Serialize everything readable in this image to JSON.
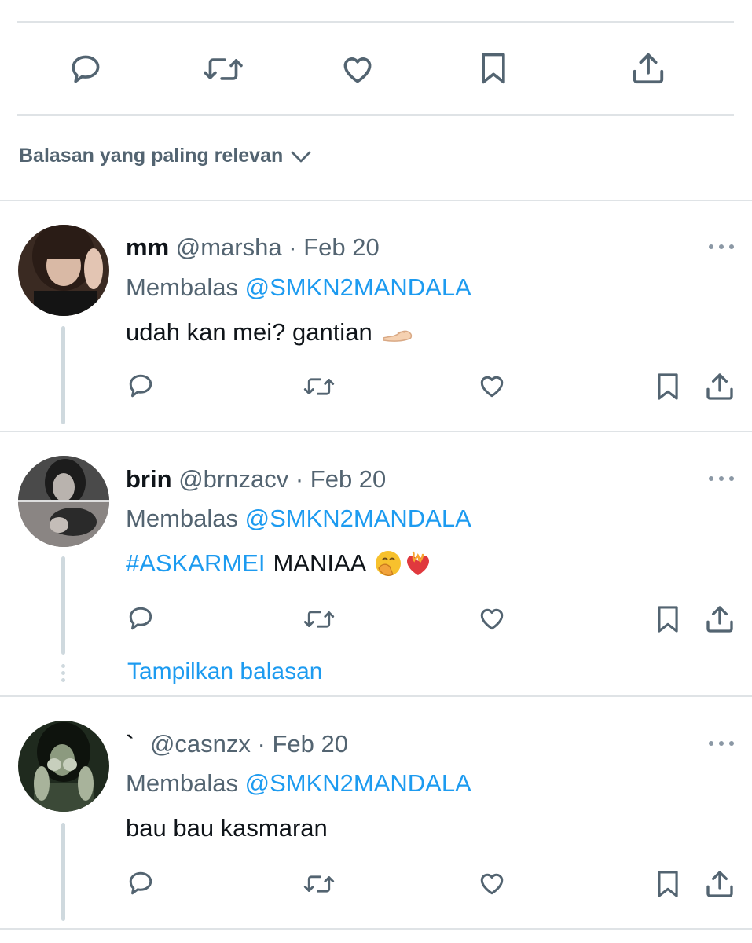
{
  "colors": {
    "accent": "#1d9bf0",
    "muted": "#536471",
    "divider": "#dfe3e6"
  },
  "main_actions": [
    "reply-icon",
    "retweet-icon",
    "like-icon",
    "bookmark-icon",
    "share-icon"
  ],
  "sort": {
    "label": "Balasan yang paling relevan",
    "icon": "chevron-down-icon"
  },
  "replies": [
    {
      "name": "mm",
      "handle": "@marsha",
      "separator": "·",
      "date": "Feb 20",
      "replying_prefix": "Membalas",
      "replying_to": "@SMKN2MANDALA",
      "text": "udah kan mei? gantian",
      "emoji": "palm-up-hand-emoji"
    },
    {
      "name": "brin",
      "handle": "@brnzacv",
      "separator": "·",
      "date": "Feb 20",
      "replying_prefix": "Membalas",
      "replying_to": "@SMKN2MANDALA",
      "hashtag": "#ASKARMEI",
      "text": "MANIAA",
      "emoji": "hand-over-mouth-emoji, heart-on-fire-emoji",
      "show_replies": "Tampilkan balasan"
    },
    {
      "name": "`",
      "handle": "@casnzx",
      "separator": "·",
      "date": "Feb 20",
      "replying_prefix": "Membalas",
      "replying_to": "@SMKN2MANDALA",
      "text": "bau bau kasmaran"
    }
  ]
}
